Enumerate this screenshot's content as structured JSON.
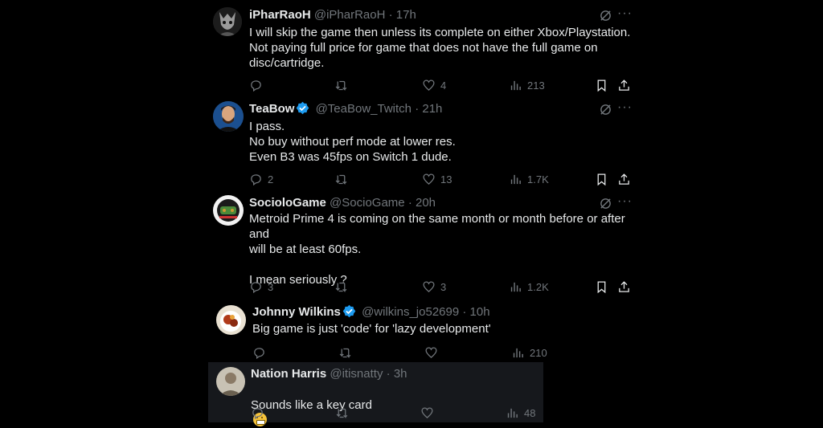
{
  "tweets": [
    {
      "name": "iPharRaoH",
      "handle": "@iPharRaoH",
      "time": "17h",
      "verified": false,
      "text": "I will skip the game then unless its complete on either Xbox/Playstation.\nNot paying full price for game that does not have the full game on\ndisc/cartridge.",
      "replies": "",
      "retweets": "",
      "likes": "4",
      "views": "213"
    },
    {
      "name": "TeaBow",
      "handle": "@TeaBow_Twitch",
      "time": "21h",
      "verified": true,
      "text": "I pass.\nNo buy without perf mode at lower res.\nEven B3 was 45fps on Switch 1 dude.",
      "replies": "2",
      "retweets": "",
      "likes": "13",
      "views": "1.7K"
    },
    {
      "name": "SocioloGame",
      "handle": "@SocioGame",
      "time": "20h",
      "verified": false,
      "text": "Metroid Prime 4 is coming on the same month or month before or after and\nwill be at least 60fps.\n\nI mean seriously ?",
      "replies": "3",
      "retweets": "",
      "likes": "3",
      "views": "1.2K"
    },
    {
      "name": "Johnny Wilkins",
      "handle": "@wilkins_jo52699",
      "time": "10h",
      "verified": true,
      "text": "Big game is just 'code' for 'lazy development'",
      "replies": "",
      "retweets": "",
      "likes": "",
      "views": "210"
    },
    {
      "name": "Nation Harris",
      "handle": "@itisnatty",
      "time": "3h",
      "verified": false,
      "text": "Sounds like a key card",
      "replies": "",
      "retweets": "",
      "likes": "",
      "views": "48"
    }
  ],
  "separator": "·",
  "icons": {
    "reply": "reply-icon",
    "retweet": "retweet-icon",
    "like": "heart-icon",
    "views": "views-icon",
    "bookmark": "bookmark-icon",
    "share": "share-icon",
    "grok": "grok-icon",
    "more": "more-icon",
    "verified": "verified-badge-icon",
    "emoji": "grimacing-emoji-icon"
  },
  "colors": {
    "background": "#000000",
    "text": "#e7e9ea",
    "muted": "#71767b",
    "verified": "#1d9bf0",
    "highlight_bg": "#16181c"
  }
}
